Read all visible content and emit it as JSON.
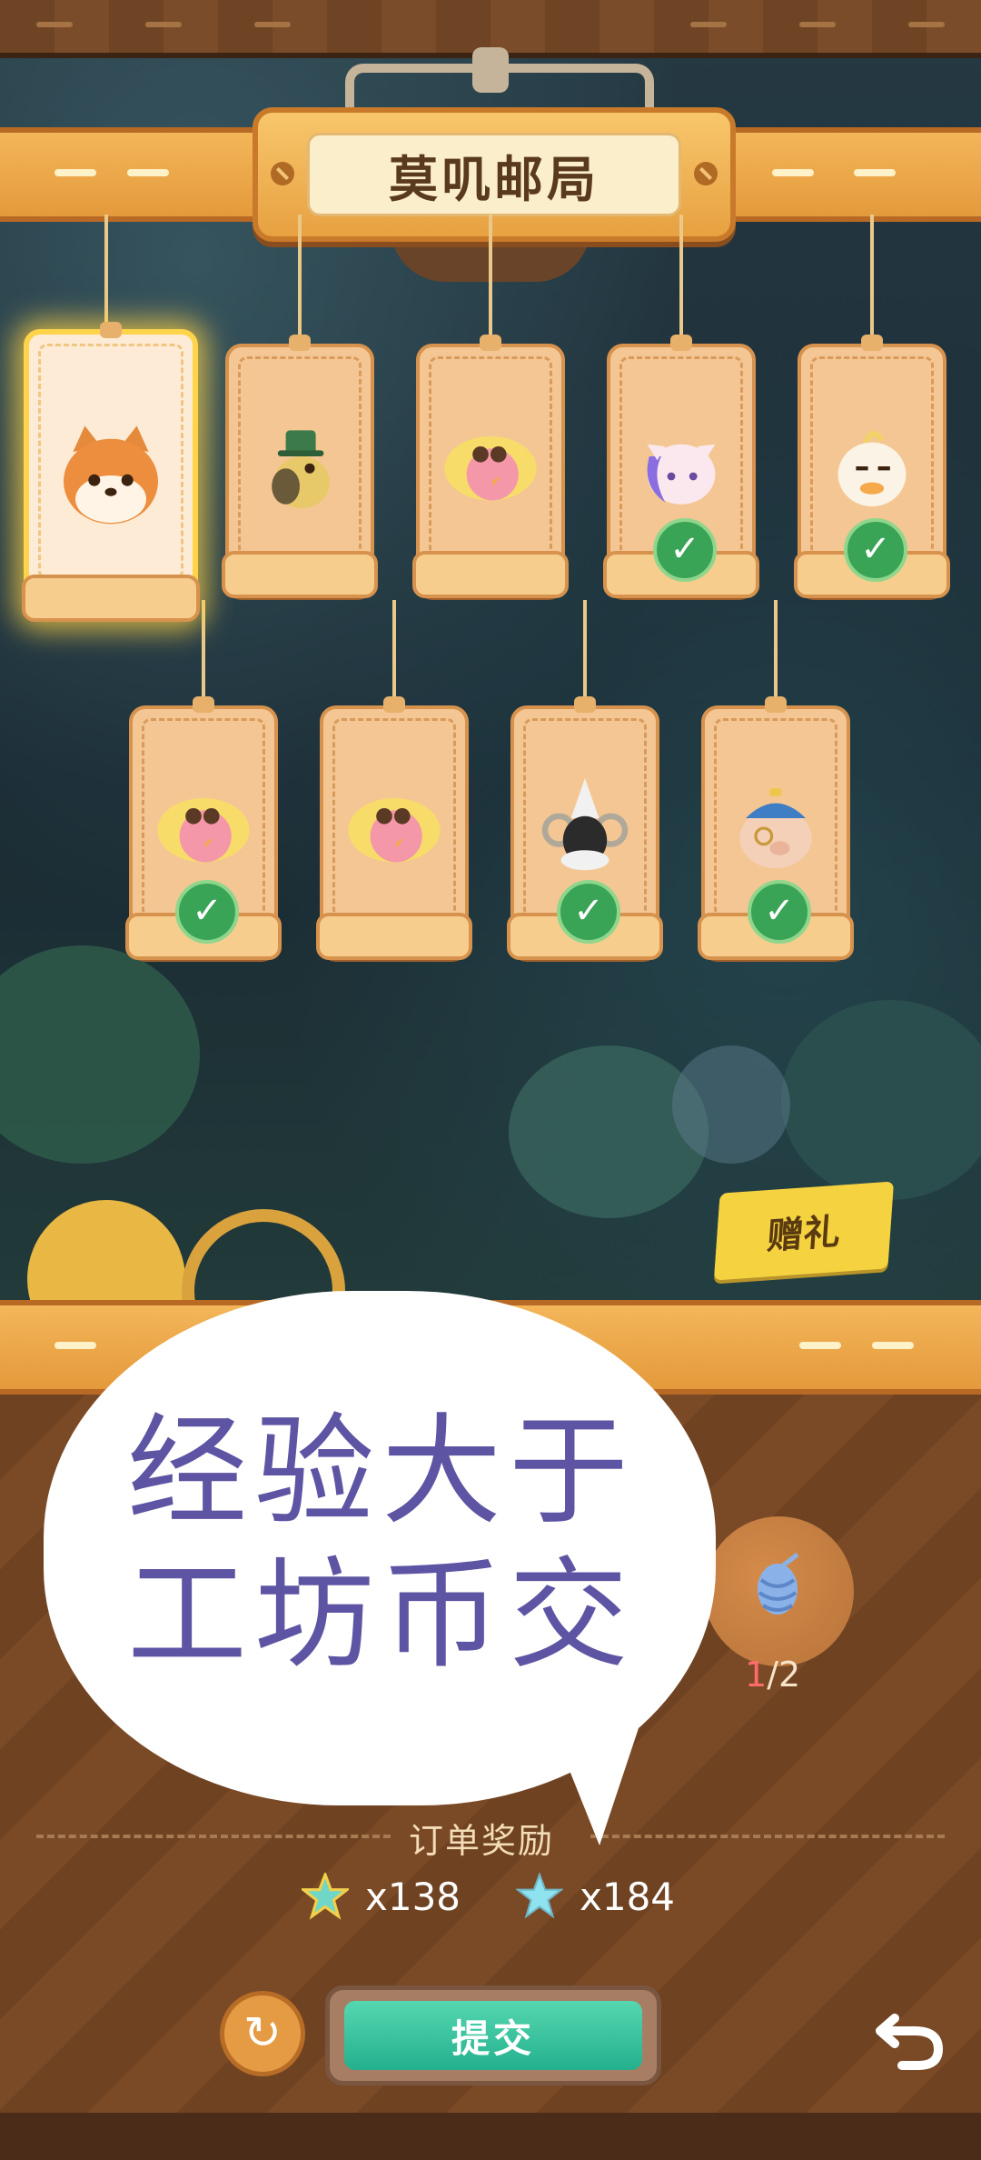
{
  "header": {
    "title": "莫叽邮局"
  },
  "cards": [
    {
      "name": "shiba-dog",
      "selected": true,
      "completed": false
    },
    {
      "name": "duck-green-hat",
      "selected": false,
      "completed": false
    },
    {
      "name": "pink-chick-sunglasses",
      "selected": false,
      "completed": false
    },
    {
      "name": "unicorn",
      "selected": false,
      "completed": true
    },
    {
      "name": "white-duck",
      "selected": false,
      "completed": true
    },
    {
      "name": "pink-chick-sunglasses",
      "selected": false,
      "completed": true
    },
    {
      "name": "pink-chick-sunglasses",
      "selected": false,
      "completed": false
    },
    {
      "name": "ram-wizard",
      "selected": false,
      "completed": true
    },
    {
      "name": "pig-propeller-hat",
      "selected": false,
      "completed": true
    }
  ],
  "gift_label": "赠礼",
  "speech_bubble": {
    "line1": "经验大于",
    "line2": "工坊币交"
  },
  "requirement": {
    "icon": "yarn-icon",
    "have": "1",
    "sep_need": "/2"
  },
  "rewards": {
    "label": "订单奖励",
    "items": [
      {
        "icon": "exp-star-icon",
        "amount": "x138"
      },
      {
        "icon": "coin-star-icon",
        "amount": "x184"
      }
    ]
  },
  "actions": {
    "submit": "提交",
    "refresh_icon": "↻"
  },
  "colors": {
    "accent": "#f3b659",
    "submit": "#2fbf97",
    "bubble_text": "#5d55a3",
    "check": "#3aa456"
  }
}
